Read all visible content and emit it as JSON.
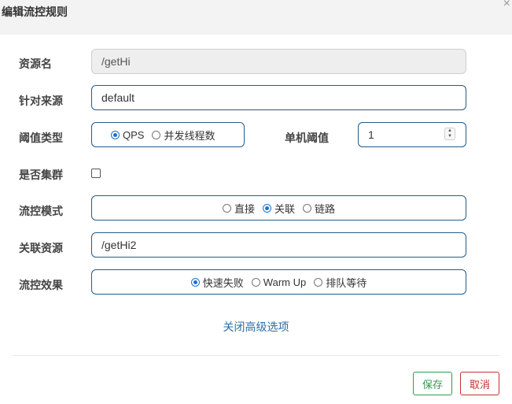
{
  "dialog": {
    "title": "编辑流控规则",
    "close_label": "×"
  },
  "form": {
    "resource": {
      "label": "资源名",
      "value": "/getHi"
    },
    "limit_app": {
      "label": "针对来源",
      "value": "default"
    },
    "grade": {
      "label": "阈值类型",
      "options": [
        {
          "label": "QPS",
          "selected": true
        },
        {
          "label": "并发线程数",
          "selected": false
        }
      ]
    },
    "count": {
      "label": "单机阈值",
      "value": "1"
    },
    "cluster": {
      "label": "是否集群",
      "checked": false
    },
    "strategy": {
      "label": "流控模式",
      "options": [
        {
          "label": "直接",
          "selected": false
        },
        {
          "label": "关联",
          "selected": true
        },
        {
          "label": "链路",
          "selected": false
        }
      ]
    },
    "ref_resource": {
      "label": "关联资源",
      "value": "/getHi2"
    },
    "control_behavior": {
      "label": "流控效果",
      "options": [
        {
          "label": "快速失败",
          "selected": true
        },
        {
          "label": "Warm Up",
          "selected": false
        },
        {
          "label": "排队等待",
          "selected": false
        }
      ]
    }
  },
  "advanced_toggle_label": "关闭高级选项",
  "footer": {
    "save_label": "保存",
    "cancel_label": "取消"
  },
  "colors": {
    "border": "#1f5d8c",
    "radio_selected": "#1a73c9",
    "link": "#2f6ea4",
    "save": "#2f9a4f",
    "cancel": "#c9302c"
  }
}
